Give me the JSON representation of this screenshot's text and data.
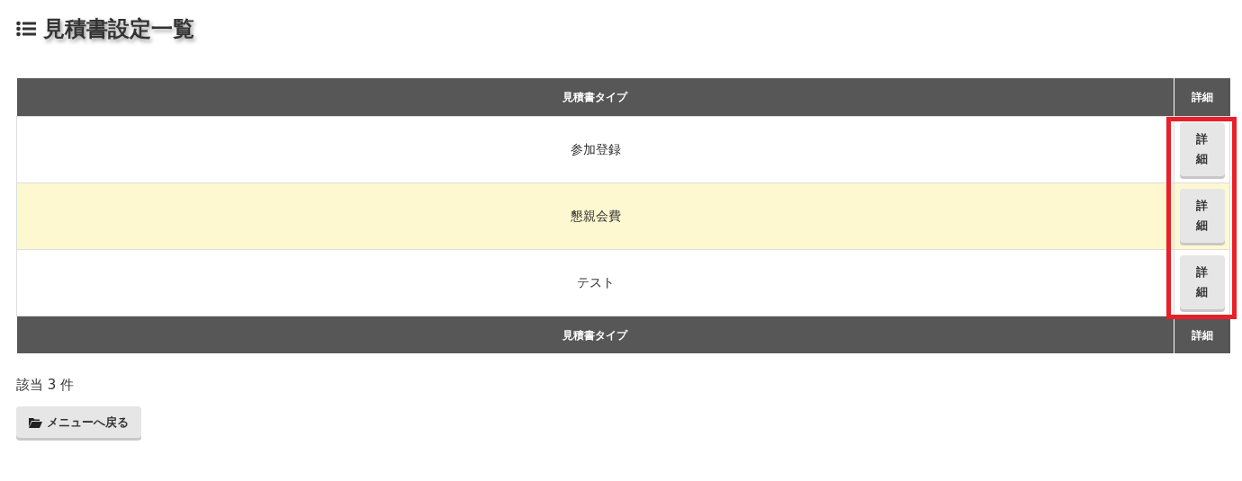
{
  "page_title": "見積書設定一覧",
  "table": {
    "columns": [
      "見積書タイプ",
      "詳細"
    ],
    "rows": [
      {
        "type": "参加登録",
        "button": "詳細",
        "highlighted": false
      },
      {
        "type": "懇親会費",
        "button": "詳細",
        "highlighted": true
      },
      {
        "type": "テスト",
        "button": "詳細",
        "highlighted": false
      }
    ],
    "footer_columns": [
      "見積書タイプ",
      "詳細"
    ],
    "details_column_marked": true
  },
  "result_count": "該当 3 件",
  "back_button": "メニューへ戻る"
}
